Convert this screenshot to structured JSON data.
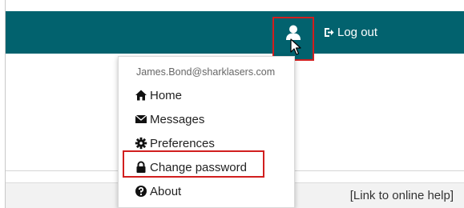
{
  "navbar": {
    "user_icon": "user-icon",
    "logout_label": "Log out",
    "logout_icon": "sign-out-icon"
  },
  "dropdown": {
    "email": "James.Bond@sharklasers.com",
    "items": [
      {
        "label": "Home",
        "icon": "home-icon"
      },
      {
        "label": "Messages",
        "icon": "envelope-icon"
      },
      {
        "label": "Preferences",
        "icon": "gear-icon"
      },
      {
        "label": "Change password",
        "icon": "lock-icon"
      },
      {
        "label": "About",
        "icon": "question-circle-icon"
      }
    ]
  },
  "footer": {
    "help_link": "[Link to online help]"
  },
  "colors": {
    "navbar": "#02626e",
    "highlight": "#d11f1f"
  }
}
